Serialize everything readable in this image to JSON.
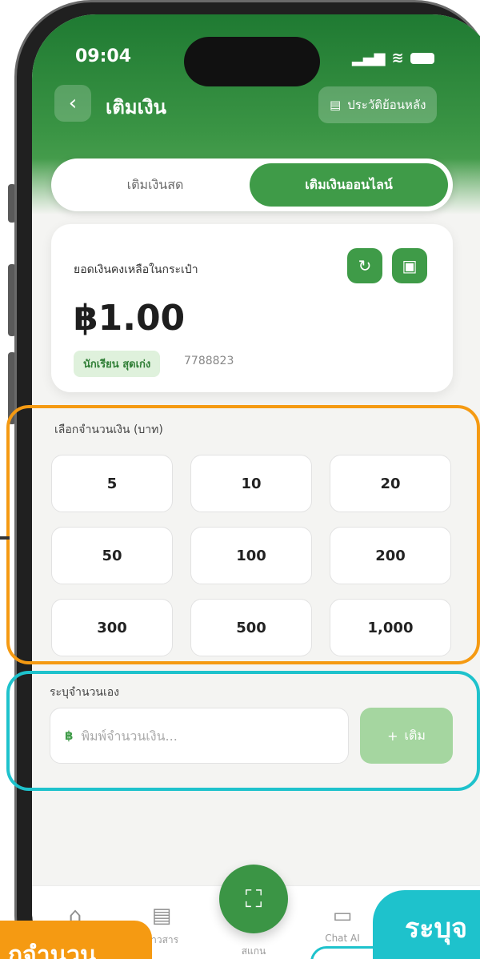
{
  "status": {
    "time": "09:04"
  },
  "header": {
    "title": "เติมเงิน",
    "history_label": "ประวัติย้อนหลัง"
  },
  "tabs": [
    {
      "label": "เติมเงินสด",
      "active": false
    },
    {
      "label": "เติมเงินออนไลน์",
      "active": true
    }
  ],
  "balance": {
    "label": "ยอดเงินคงเหลือในกระเป๋า",
    "amount": "฿1.00",
    "name": "นักเรียน สุดเก่ง",
    "id": "7788823"
  },
  "amounts": {
    "label": "เลือกจำนวนเงิน (บาท)",
    "options": [
      "5",
      "10",
      "20",
      "50",
      "100",
      "200",
      "300",
      "500",
      "1,000"
    ]
  },
  "custom": {
    "label": "ระบุจำนวนเอง",
    "currency": "฿",
    "placeholder": "พิมพ์จำนวนเงิน...",
    "add_label": "เติม"
  },
  "nav": {
    "items": [
      {
        "label": "",
        "icon": "home-icon"
      },
      {
        "label": "ข่าวสาร",
        "icon": "news-icon"
      },
      {
        "label": "สแกน",
        "icon": "scan-icon"
      },
      {
        "label": "Chat AI",
        "icon": "chat-icon"
      }
    ]
  },
  "callouts": {
    "orange": "กจำนวน",
    "cyan": "ระบุจ"
  },
  "colors": {
    "brand_green": "#3f9b48",
    "highlight_orange": "#f59a12",
    "highlight_cyan": "#1ec2cc"
  }
}
